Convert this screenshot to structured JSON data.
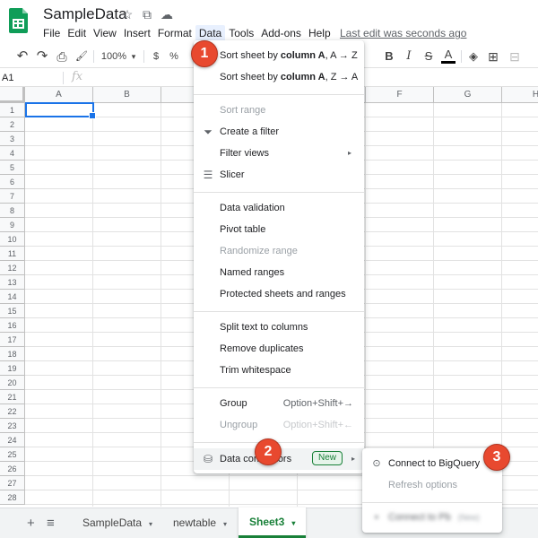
{
  "header": {
    "title": "SampleData",
    "star_icon": "☆",
    "folder_icon": "⧉",
    "cloud_icon": "☁",
    "last_edit": "Last edit was seconds ago"
  },
  "menubar": {
    "items": [
      "File",
      "Edit",
      "View",
      "Insert",
      "Format",
      "Data",
      "Tools",
      "Add-ons",
      "Help"
    ],
    "active": "Data"
  },
  "toolbar": {
    "undo": "↶",
    "redo": "↷",
    "print": "⎙",
    "paint_format": "🖌",
    "zoom": "100%",
    "zoom_caret": "▾",
    "currency": "$",
    "percent": "%",
    "bold": "B",
    "italic": "I",
    "strikethrough": "S",
    "text_color": "A",
    "fill": "◈",
    "borders": "⊞",
    "merge": "⊟"
  },
  "formula_bar": {
    "cell_ref": "A1",
    "fx": "fx"
  },
  "grid": {
    "columns": [
      "A",
      "B",
      "",
      "",
      "",
      "F",
      "G",
      "H"
    ],
    "rows": [
      "1",
      "2",
      "3",
      "4",
      "5",
      "6",
      "7",
      "8",
      "9",
      "10",
      "11",
      "12",
      "13",
      "14",
      "15",
      "16",
      "17",
      "18",
      "19",
      "20",
      "21",
      "22",
      "23",
      "24",
      "25",
      "26",
      "27",
      "28"
    ]
  },
  "sheet_tabs": {
    "add": "+",
    "all_sheets": "≡",
    "tabs": [
      {
        "label": "SampleData",
        "active": false
      },
      {
        "label": "newtable",
        "active": false
      },
      {
        "label": "Sheet3",
        "active": true
      }
    ],
    "caret": "▾"
  },
  "data_menu": {
    "items": [
      {
        "label_prefix": "Sort sheet by ",
        "label_bold": "column A",
        "label_suffix": ", A → Z",
        "disabled": false
      },
      {
        "label_prefix": "Sort sheet by ",
        "label_bold": "column A",
        "label_suffix": ", Z → A",
        "disabled": false
      },
      {
        "label": "Sort range",
        "disabled": true
      },
      {
        "label": "Create a filter",
        "icon": "filter-icon",
        "glyph": "⏷",
        "disabled": false
      },
      {
        "label": "Filter views",
        "submenu": true,
        "disabled": false
      },
      {
        "label": "Slicer",
        "icon": "slicer-icon",
        "glyph": "☰",
        "disabled": false
      },
      {
        "label": "Data validation",
        "disabled": false
      },
      {
        "label": "Pivot table",
        "disabled": false
      },
      {
        "label": "Randomize range",
        "disabled": true
      },
      {
        "label": "Named ranges",
        "disabled": false
      },
      {
        "label": "Protected sheets and ranges",
        "disabled": false
      },
      {
        "label": "Split text to columns",
        "disabled": false
      },
      {
        "label": "Remove duplicates",
        "disabled": false
      },
      {
        "label": "Trim whitespace",
        "disabled": false
      },
      {
        "label": "Group",
        "shortcut": "Option+Shift+→",
        "disabled": false
      },
      {
        "label": "Ungroup",
        "shortcut": "Option+Shift+←",
        "disabled": true
      },
      {
        "label": "Data connectors",
        "icon": "database-icon",
        "glyph": "⛁",
        "badge": "New",
        "submenu": true,
        "disabled": false
      }
    ],
    "submenu_arrow": "▸"
  },
  "connectors_submenu": {
    "items": [
      {
        "label": "Connect to BigQuery",
        "icon": "bigquery-icon",
        "glyph": "⊙",
        "disabled": false
      },
      {
        "label": "Refresh options",
        "disabled": true
      },
      {
        "label": "Connect to Pb",
        "tag": "(New)",
        "icon": "connector-icon",
        "glyph": "▪",
        "blurred": true
      }
    ]
  },
  "annotations": [
    "1",
    "2",
    "3"
  ],
  "colors": {
    "accent_green": "#188038",
    "selection_blue": "#1a73e8",
    "badge_red": "#e8492f",
    "menu_active_bg": "#e8f0fe"
  }
}
